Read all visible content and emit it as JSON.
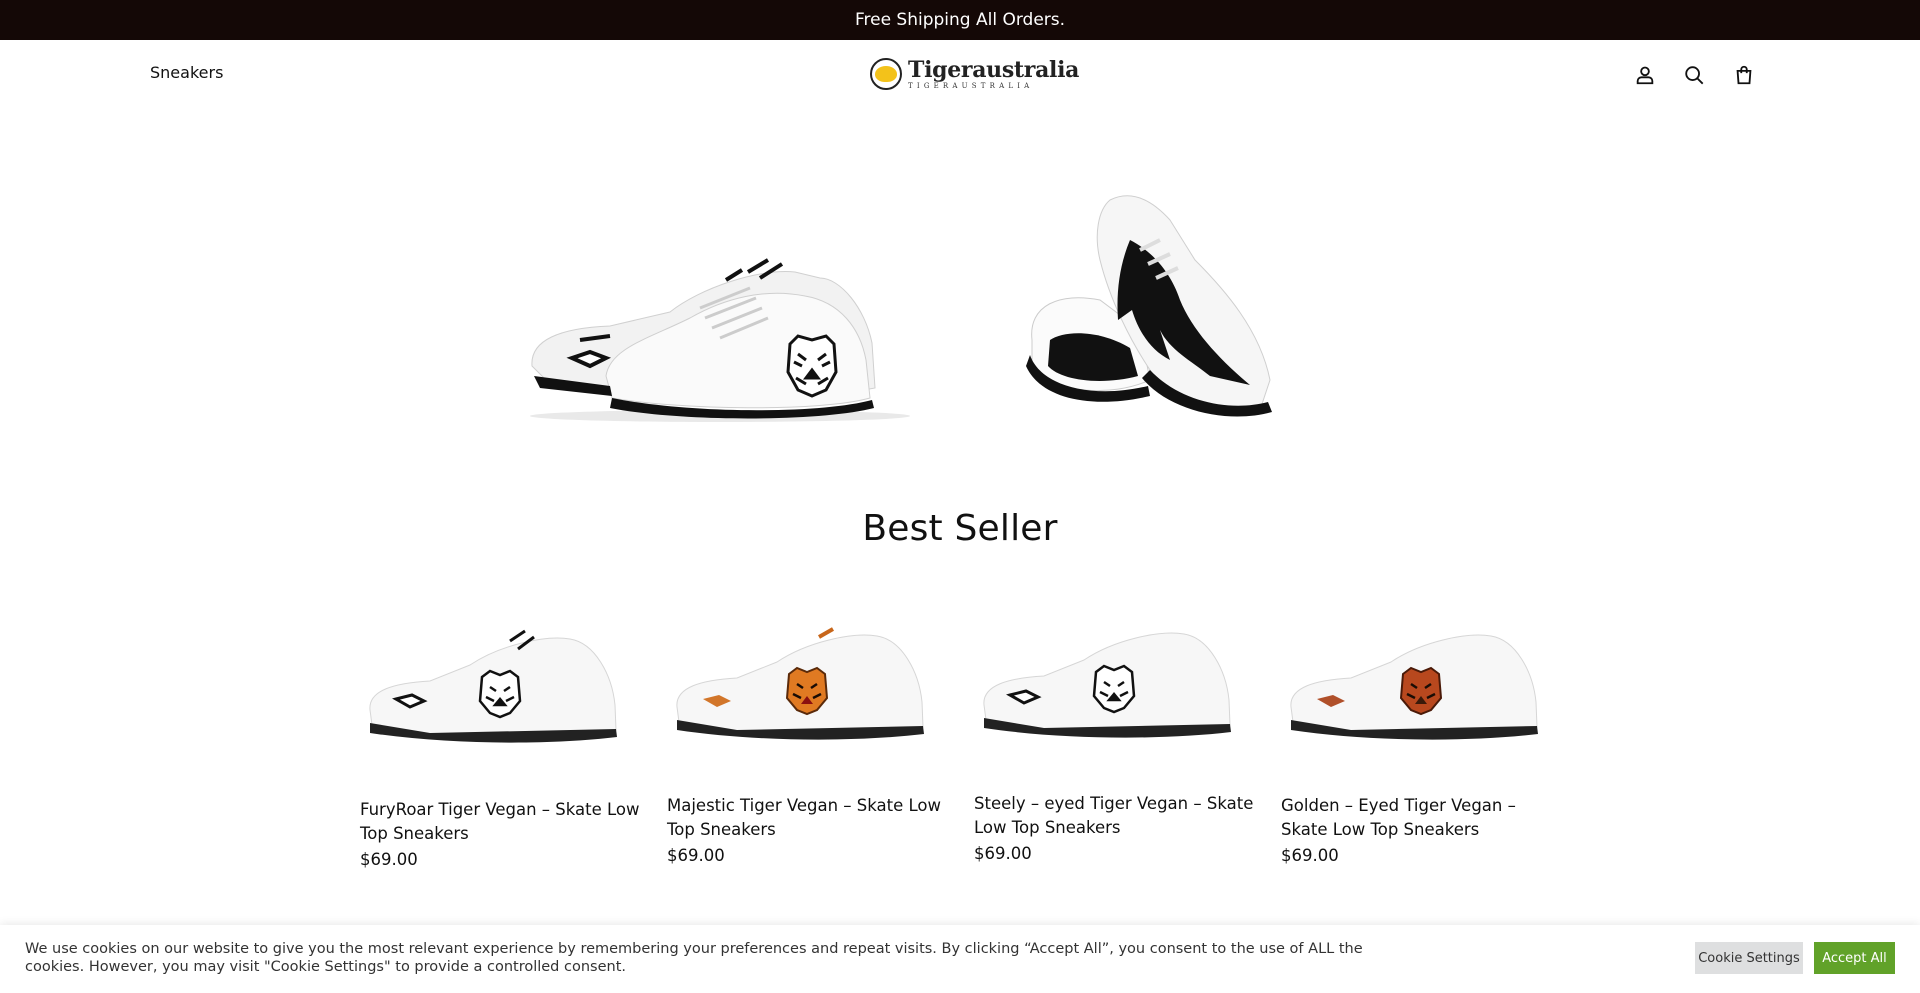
{
  "announcement": {
    "text": "Free Shipping All Orders."
  },
  "header": {
    "nav": [
      {
        "label": "Sneakers"
      }
    ],
    "logo": {
      "title": "Tigeraustralia",
      "subtitle": "TIGERAUSTRALIA"
    },
    "icons": [
      "account-icon",
      "search-icon",
      "cart-icon"
    ]
  },
  "hero": {
    "images": [
      "low-top-tiger-sneaker",
      "running-tiger-sneaker"
    ]
  },
  "best_seller": {
    "title": "Best Seller",
    "products": [
      {
        "name": "FuryRoar Tiger Vegan – Skate Low Top Sneakers",
        "price": "$69.00",
        "tiger": "black-white"
      },
      {
        "name": "Majestic Tiger Vegan – Skate Low Top Sneakers",
        "price": "$69.00",
        "tiger": "orange"
      },
      {
        "name": "Steely – eyed Tiger Vegan – Skate Low Top Sneakers",
        "price": "$69.00",
        "tiger": "black-white"
      },
      {
        "name": "Golden – Eyed Tiger Vegan – Skate Low Top Sneakers",
        "price": "$69.00",
        "tiger": "orange"
      }
    ]
  },
  "cookie": {
    "text": "We use cookies on our website to give you the most relevant experience by remembering your preferences and repeat visits. By clicking “Accept All”, you consent to the use of ALL the cookies. However, you may visit \"Cookie Settings\" to provide a controlled consent.",
    "settings_label": "Cookie Settings",
    "accept_label": "Accept All"
  },
  "colors": {
    "topbar": "#140806",
    "accept": "#61a229",
    "settings": "#dedfe0"
  }
}
